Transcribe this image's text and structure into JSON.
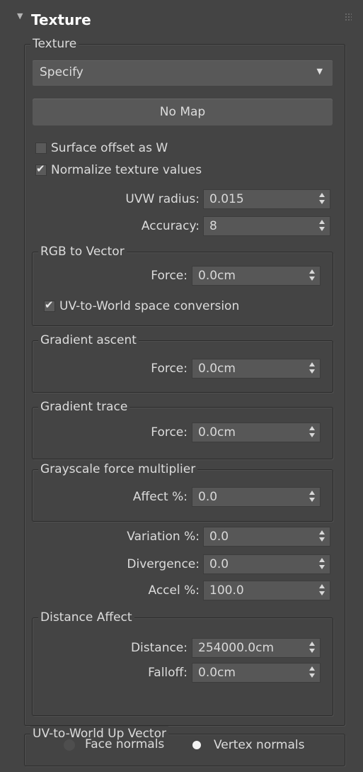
{
  "rollout": {
    "title": "Texture",
    "arrow": "▼"
  },
  "texture_group": {
    "title": "Texture",
    "dropdown_value": "Specify",
    "map_button": "No Map",
    "surface_offset": {
      "label": "Surface offset as W",
      "checked": false
    },
    "normalize": {
      "label": "Normalize texture values",
      "checked": true
    },
    "uvw_radius": {
      "label": "UVW radius:",
      "value": "0.015"
    },
    "accuracy": {
      "label": "Accuracy:",
      "value": "8"
    }
  },
  "rgb_to_vector": {
    "title": "RGB to Vector",
    "force": {
      "label": "Force:",
      "value": "0.0cm"
    },
    "conversion": {
      "label": "UV-to-World space conversion",
      "checked": true
    }
  },
  "gradient_ascent": {
    "title": "Gradient ascent",
    "force": {
      "label": "Force:",
      "value": "0.0cm"
    }
  },
  "gradient_trace": {
    "title": "Gradient trace",
    "force": {
      "label": "Force:",
      "value": "0.0cm"
    }
  },
  "grayscale": {
    "title": "Grayscale force multiplier",
    "affect": {
      "label": "Affect %:",
      "value": "0.0"
    }
  },
  "variation": {
    "label": "Variation %:",
    "value": "0.0"
  },
  "divergence": {
    "label": "Divergence:",
    "value": "0.0"
  },
  "accel": {
    "label": "Accel %:",
    "value": "100.0"
  },
  "distance_affect": {
    "title": "Distance Affect",
    "distance": {
      "label": "Distance:",
      "value": "254000.0cm"
    },
    "falloff": {
      "label": "Falloff:",
      "value": "0.0cm"
    }
  },
  "up_vector": {
    "title": "UV-to-World Up Vector",
    "face_normals": {
      "label": "Face normals",
      "selected": false
    },
    "vertex_normals": {
      "label": "Vertex normals",
      "selected": true
    }
  },
  "check_glyph": "✔",
  "colors": {
    "panel_bg": "#444444",
    "field_bg": "#575757",
    "button_bg": "#585858",
    "text": "#dcdcdc"
  }
}
